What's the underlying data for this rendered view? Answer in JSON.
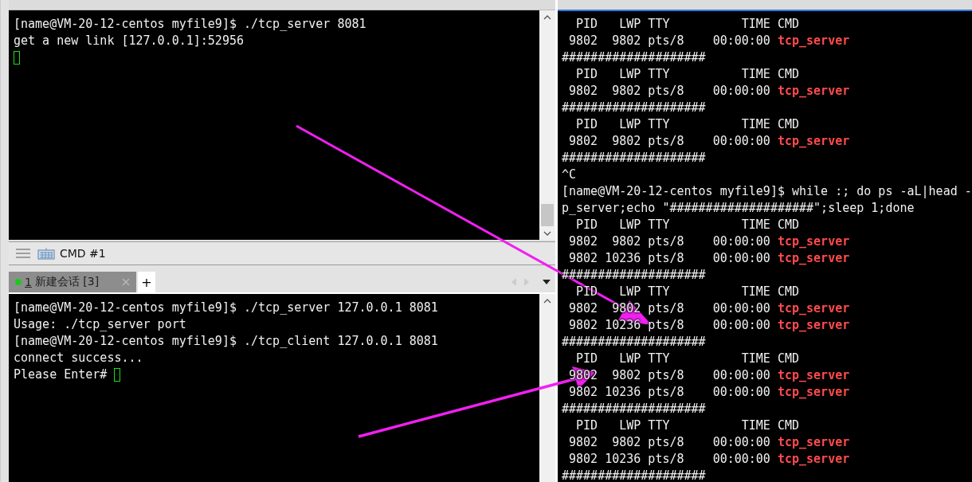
{
  "left_top_terminal": {
    "lines": [
      {
        "text": "[name@VM-20-12-centos myfile9]$ ./tcp_server 8081"
      },
      {
        "text": "get a new link [127.0.0.1]:52956"
      },
      {
        "cursor": true
      }
    ]
  },
  "command_bar": {
    "label": "CMD #1"
  },
  "bottom_tabs": [
    {
      "number": "1",
      "title": "新建会话 [3]",
      "selected": true,
      "connected": true
    }
  ],
  "add_tab_button": "+",
  "left_bottom_terminal": {
    "lines": [
      {
        "text": "[name@VM-20-12-centos myfile9]$ ./tcp_server 127.0.0.1 8081"
      },
      {
        "text": "Usage: ./tcp_server port"
      },
      {
        "text": "[name@VM-20-12-centos myfile9]$ ./tcp_client 127.0.0.1 8081"
      },
      {
        "text": "connect success..."
      },
      {
        "text": "Please Enter# ",
        "cursor": true
      }
    ]
  },
  "right_terminal": {
    "lines": [
      {
        "text": "  PID   LWP TTY          TIME CMD"
      },
      {
        "text": " 9802  9802 pts/8    00:00:00 ",
        "cmd": "tcp_server"
      },
      {
        "text": "####################"
      },
      {
        "text": "  PID   LWP TTY          TIME CMD"
      },
      {
        "text": " 9802  9802 pts/8    00:00:00 ",
        "cmd": "tcp_server"
      },
      {
        "text": "####################"
      },
      {
        "text": "  PID   LWP TTY          TIME CMD"
      },
      {
        "text": " 9802  9802 pts/8    00:00:00 ",
        "cmd": "tcp_server"
      },
      {
        "text": "####################"
      },
      {
        "text": "^C"
      },
      {
        "text": "[name@VM-20-12-centos myfile9]$ while :; do ps -aL|head -"
      },
      {
        "text": "p_server;echo \"####################\";sleep 1;done"
      },
      {
        "text": "  PID   LWP TTY          TIME CMD"
      },
      {
        "text": " 9802  9802 pts/8    00:00:00 ",
        "cmd": "tcp_server"
      },
      {
        "text": " 9802 10236 pts/8    00:00:00 ",
        "cmd": "tcp_server"
      },
      {
        "text": "####################"
      },
      {
        "text": "  PID   LWP TTY          TIME CMD"
      },
      {
        "text": " 9802  9802 pts/8    00:00:00 ",
        "cmd": "tcp_server"
      },
      {
        "text": " 9802 10236 pts/8    00:00:00 ",
        "cmd": "tcp_server"
      },
      {
        "text": "####################"
      },
      {
        "text": "  PID   LWP TTY          TIME CMD"
      },
      {
        "text": " 9802  9802 pts/8    00:00:00 ",
        "cmd": "tcp_server"
      },
      {
        "text": " 9802 10236 pts/8    00:00:00 ",
        "cmd": "tcp_server"
      },
      {
        "text": "####################"
      },
      {
        "text": "  PID   LWP TTY          TIME CMD"
      },
      {
        "text": " 9802  9802 pts/8    00:00:00 ",
        "cmd": "tcp_server"
      },
      {
        "text": " 9802 10236 pts/8    00:00:00 ",
        "cmd": "tcp_server"
      },
      {
        "text": "####################"
      }
    ]
  }
}
